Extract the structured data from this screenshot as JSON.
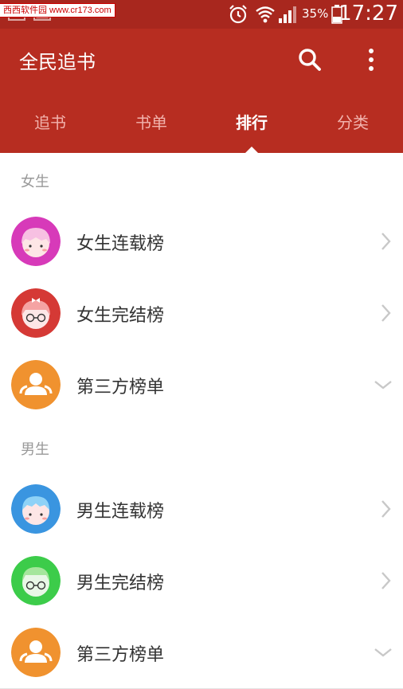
{
  "watermark": "西西软件园 www.cr173.com",
  "status_bar": {
    "battery": "35%",
    "time": "17:27"
  },
  "app_bar": {
    "title": "全民追书"
  },
  "tabs": [
    {
      "label": "追书",
      "active": false
    },
    {
      "label": "书单",
      "active": false
    },
    {
      "label": "排行",
      "active": true
    },
    {
      "label": "分类",
      "active": false
    }
  ],
  "sections": [
    {
      "title": "女生",
      "items": [
        {
          "label": "女生连载榜",
          "icon": "girl-face-icon",
          "color": "#d73ab9",
          "indicator": "chevron-right"
        },
        {
          "label": "女生完结榜",
          "icon": "girl-glasses-icon",
          "color": "#d53935",
          "indicator": "chevron-right"
        },
        {
          "label": "第三方榜单",
          "icon": "people-icon",
          "color": "#f0922f",
          "indicator": "chevron-down"
        }
      ]
    },
    {
      "title": "男生",
      "items": [
        {
          "label": "男生连载榜",
          "icon": "boy-face-icon",
          "color": "#3a95e0",
          "indicator": "chevron-right"
        },
        {
          "label": "男生完结榜",
          "icon": "boy-glasses-icon",
          "color": "#3ccc4a",
          "indicator": "chevron-right"
        },
        {
          "label": "第三方榜单",
          "icon": "people-icon",
          "color": "#f0922f",
          "indicator": "chevron-down"
        }
      ]
    }
  ]
}
